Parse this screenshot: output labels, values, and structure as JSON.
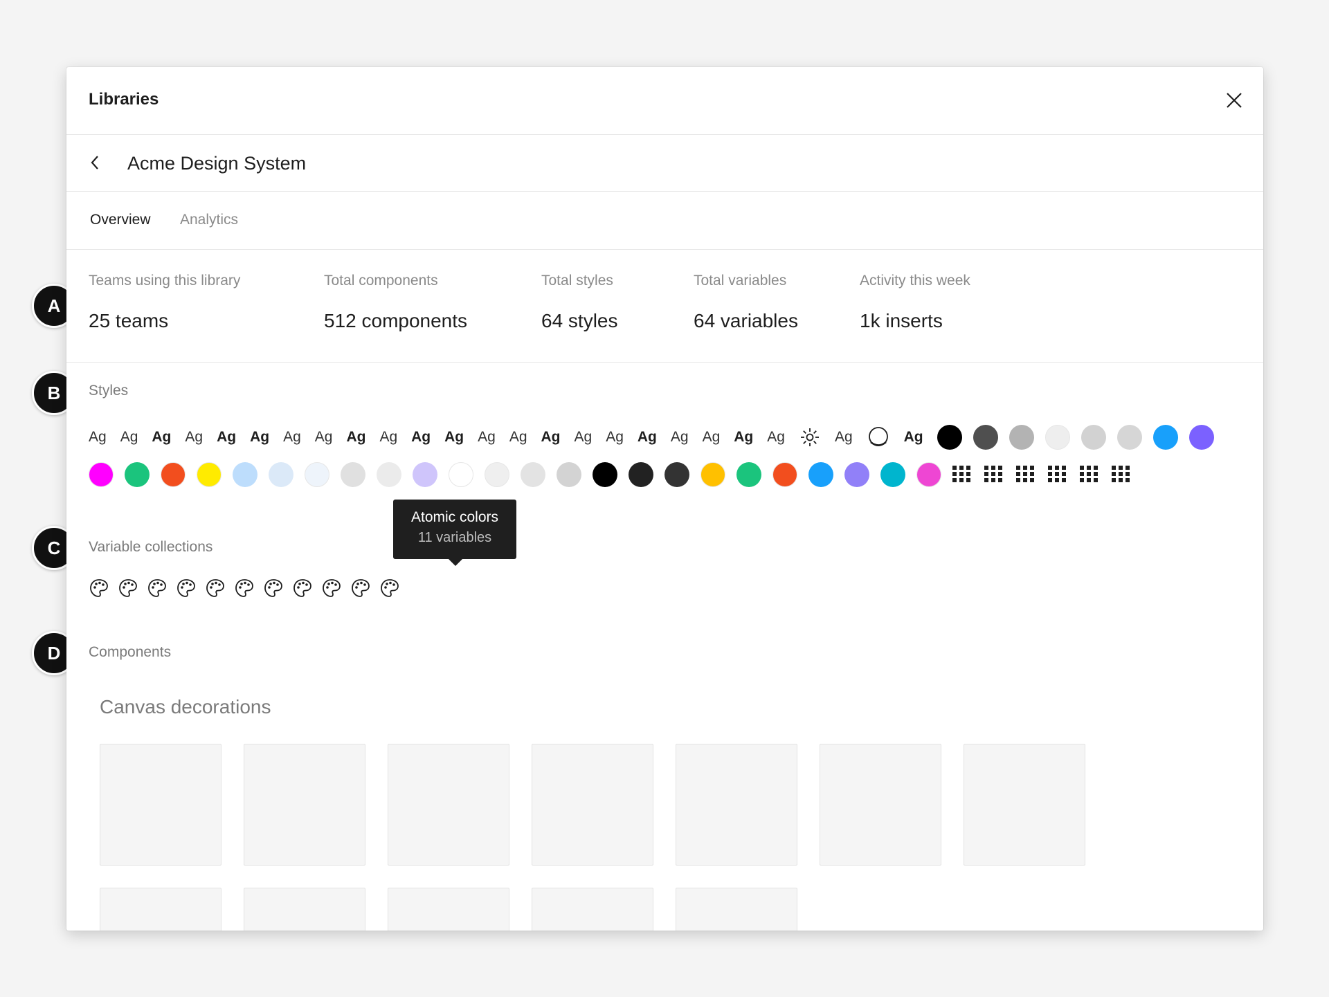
{
  "header": {
    "title": "Libraries"
  },
  "library": {
    "name": "Acme Design System"
  },
  "tabs": [
    {
      "label": "Overview",
      "active": true
    },
    {
      "label": "Analytics",
      "active": false
    }
  ],
  "stats": [
    {
      "label": "Teams using this library",
      "value": "25 teams"
    },
    {
      "label": "Total components",
      "value": "512 components"
    },
    {
      "label": "Total styles",
      "value": "64 styles"
    },
    {
      "label": "Total variables",
      "value": "64 variables"
    },
    {
      "label": "Activity this week",
      "value": "1k inserts"
    }
  ],
  "sections": {
    "styles": "Styles",
    "variable_collections": "Variable collections",
    "components": "Components"
  },
  "styles_row1": [
    {
      "kind": "text",
      "label": "Ag",
      "bold": false
    },
    {
      "kind": "text",
      "label": "Ag",
      "bold": false
    },
    {
      "kind": "text",
      "label": "Ag",
      "bold": true
    },
    {
      "kind": "text",
      "label": "Ag",
      "bold": false
    },
    {
      "kind": "text",
      "label": "Ag",
      "bold": true
    },
    {
      "kind": "text",
      "label": "Ag",
      "bold": true
    },
    {
      "kind": "text",
      "label": "Ag",
      "bold": false
    },
    {
      "kind": "text",
      "label": "Ag",
      "bold": false
    },
    {
      "kind": "text",
      "label": "Ag",
      "bold": true
    },
    {
      "kind": "text",
      "label": "Ag",
      "bold": false
    },
    {
      "kind": "text",
      "label": "Ag",
      "bold": true
    },
    {
      "kind": "text",
      "label": "Ag",
      "bold": true
    },
    {
      "kind": "text",
      "label": "Ag",
      "bold": false
    },
    {
      "kind": "text",
      "label": "Ag",
      "bold": false
    },
    {
      "kind": "text",
      "label": "Ag",
      "bold": true
    },
    {
      "kind": "text",
      "label": "Ag",
      "bold": false
    },
    {
      "kind": "text",
      "label": "Ag",
      "bold": false
    },
    {
      "kind": "text",
      "label": "Ag",
      "bold": true
    },
    {
      "kind": "text",
      "label": "Ag",
      "bold": false
    },
    {
      "kind": "text",
      "label": "Ag",
      "bold": false
    },
    {
      "kind": "text",
      "label": "Ag",
      "bold": true
    },
    {
      "kind": "text",
      "label": "Ag",
      "bold": false
    },
    {
      "kind": "icon",
      "icon": "sun-icon"
    },
    {
      "kind": "text",
      "label": "Ag",
      "bold": false
    },
    {
      "kind": "icon",
      "icon": "shadow-circle-icon"
    },
    {
      "kind": "text",
      "label": "Ag",
      "bold": true
    },
    {
      "kind": "swatch",
      "color": "#000000"
    },
    {
      "kind": "swatch",
      "color": "#4f4f4f"
    },
    {
      "kind": "swatch",
      "color": "#b3b3b3"
    },
    {
      "kind": "swatch",
      "color": "#eeeeee"
    },
    {
      "kind": "swatch",
      "color": "#d2d2d2"
    },
    {
      "kind": "swatch",
      "color": "#d6d6d6"
    },
    {
      "kind": "swatch",
      "color": "#18a0fb"
    },
    {
      "kind": "swatch",
      "color": "#7b61ff"
    }
  ],
  "styles_row2": [
    {
      "kind": "swatch",
      "color": "#ff00ff"
    },
    {
      "kind": "swatch",
      "color": "#1bc47d"
    },
    {
      "kind": "swatch",
      "color": "#f24e1e"
    },
    {
      "kind": "swatch",
      "color": "#ffeb00"
    },
    {
      "kind": "swatch",
      "color": "#bdddfc"
    },
    {
      "kind": "swatch",
      "color": "#dbe9f8"
    },
    {
      "kind": "swatch",
      "color": "#eef4fb"
    },
    {
      "kind": "swatch",
      "color": "#e0e0e0"
    },
    {
      "kind": "swatch",
      "color": "#ebebeb"
    },
    {
      "kind": "swatch",
      "color": "#cfc5fb"
    },
    {
      "kind": "swatch",
      "color": "#ffffff"
    },
    {
      "kind": "swatch",
      "color": "#efefef"
    },
    {
      "kind": "swatch",
      "color": "#e3e3e3"
    },
    {
      "kind": "swatch",
      "color": "#d3d3d3"
    },
    {
      "kind": "swatch",
      "color": "#000000"
    },
    {
      "kind": "swatch",
      "color": "#222222"
    },
    {
      "kind": "swatch",
      "color": "#333333"
    },
    {
      "kind": "swatch",
      "color": "#ffc000"
    },
    {
      "kind": "swatch",
      "color": "#1bc47d"
    },
    {
      "kind": "swatch",
      "color": "#f24e1e"
    },
    {
      "kind": "swatch",
      "color": "#18a0fb"
    },
    {
      "kind": "swatch",
      "color": "#9180f8"
    },
    {
      "kind": "swatch",
      "color": "#00b5ce"
    },
    {
      "kind": "swatch",
      "color": "#ee46d3"
    },
    {
      "kind": "icon",
      "icon": "grid-icon"
    },
    {
      "kind": "icon",
      "icon": "grid-icon"
    },
    {
      "kind": "icon",
      "icon": "grid-icon"
    },
    {
      "kind": "icon",
      "icon": "grid-icon"
    },
    {
      "kind": "icon",
      "icon": "grid-icon"
    },
    {
      "kind": "icon",
      "icon": "grid-icon"
    }
  ],
  "tooltip": {
    "title": "Atomic colors",
    "subtitle": "11 variables"
  },
  "variable_collections": [
    {
      "icon": "palette-icon"
    },
    {
      "icon": "palette-icon"
    },
    {
      "icon": "palette-icon"
    },
    {
      "icon": "palette-icon"
    },
    {
      "icon": "palette-icon"
    },
    {
      "icon": "palette-icon"
    },
    {
      "icon": "palette-icon"
    },
    {
      "icon": "palette-icon"
    },
    {
      "icon": "palette-icon"
    },
    {
      "icon": "palette-icon"
    },
    {
      "icon": "palette-icon"
    }
  ],
  "component_group": {
    "title": "Canvas decorations",
    "card_count": 12
  },
  "markers": [
    "A",
    "B",
    "C",
    "D"
  ]
}
